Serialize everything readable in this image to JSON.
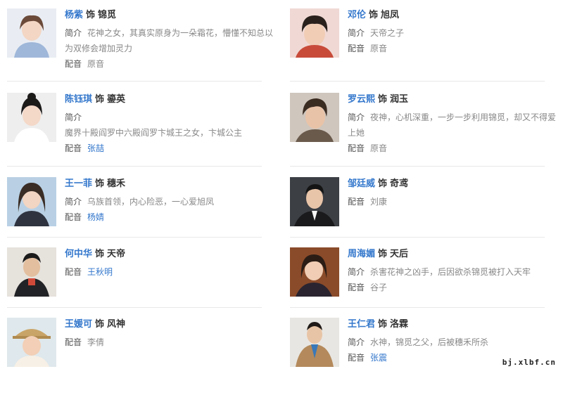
{
  "labels": {
    "intro": "简介",
    "voice": "配音",
    "as": "饰"
  },
  "cards": [
    {
      "actor": "杨紫",
      "role": "锦觅",
      "intro_text": "花神之女，其真实原身为一朵霜花，懵懂不知总以为双修会增加灵力",
      "voice": "原音",
      "voice_link": false
    },
    {
      "actor": "邓伦",
      "role": "旭凤",
      "intro_text": "天帝之子",
      "voice": "原音",
      "voice_link": false
    },
    {
      "actor": "陈钰琪",
      "role": "鎏英",
      "intro_text": "魔界十殿阎罗中六殿阎罗卞城王之女，卞城公主",
      "voice": "张喆",
      "voice_link": true
    },
    {
      "actor": "罗云熙",
      "role": "润玉",
      "intro_text": "夜神，心机深重，一步一步利用锦觅，却又不得爱上她",
      "voice": "原音",
      "voice_link": false
    },
    {
      "actor": "王一菲",
      "role": "穗禾",
      "intro_text": "乌族首领，内心险恶，一心爱旭凤",
      "voice": "杨婧",
      "voice_link": true
    },
    {
      "actor": "邹廷威",
      "role": "奇鸢",
      "intro_text": "",
      "voice": "刘康",
      "voice_link": false
    },
    {
      "actor": "何中华",
      "role": "天帝",
      "intro_text": "",
      "voice": "王秋明",
      "voice_link": true
    },
    {
      "actor": "周海媚",
      "role": "天后",
      "intro_text": "杀害花神之凶手，后因欲杀锦觅被打入天牢",
      "voice": "谷子",
      "voice_link": false
    },
    {
      "actor": "王媛可",
      "role": "风神",
      "intro_text": "",
      "voice": "李倩",
      "voice_link": false
    },
    {
      "actor": "王仁君",
      "role": "洛霖",
      "intro_text": "水神，锦觅之父，后被穗禾所杀",
      "voice": "张震",
      "voice_link": true
    }
  ],
  "watermark": "bj.xlbf.cn",
  "colors": {
    "link": "#3377cc",
    "text": "#333333",
    "muted": "#888888"
  }
}
